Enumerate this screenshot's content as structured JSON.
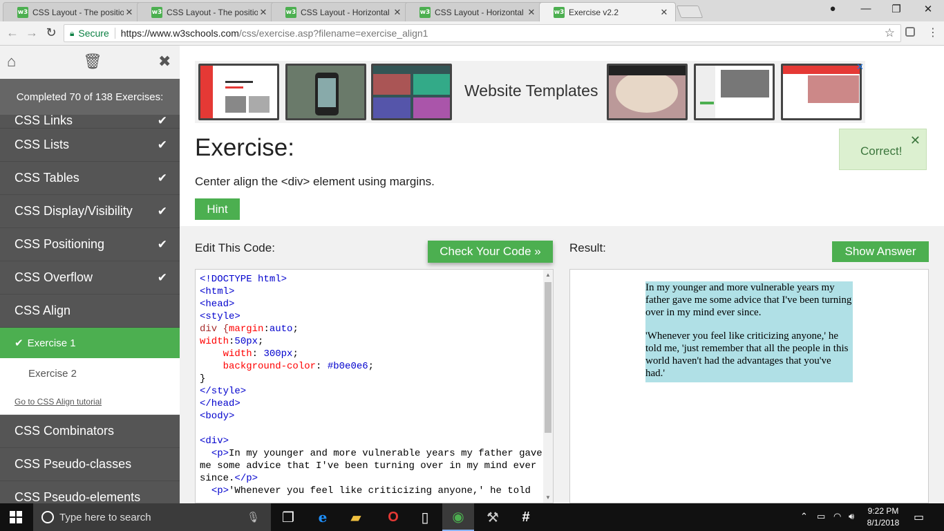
{
  "browser": {
    "tabs": [
      {
        "title": "CSS Layout - The position",
        "favicon": "w3"
      },
      {
        "title": "CSS Layout - The position",
        "favicon": "w3"
      },
      {
        "title": "CSS Layout - Horizontal &",
        "favicon": "w3"
      },
      {
        "title": "CSS Layout - Horizontal &",
        "favicon": "w3"
      },
      {
        "title": "Exercise v2.2",
        "favicon": "w3"
      }
    ],
    "active_tab": 4,
    "secure_label": "Secure",
    "url_host": "https://www.w3schools.com",
    "url_rest": "/css/exercise.asp?filename=exercise_align1"
  },
  "sidebar": {
    "completed": "Completed 70 of 138 Exercises:",
    "partial_item": "CSS Links",
    "items_top": [
      {
        "label": "CSS Lists",
        "done": true
      },
      {
        "label": "CSS Tables",
        "done": true
      },
      {
        "label": "CSS Display/Visibility",
        "done": true
      },
      {
        "label": "CSS Positioning",
        "done": true
      },
      {
        "label": "CSS Overflow",
        "done": true
      },
      {
        "label": "CSS Align",
        "done": false
      }
    ],
    "sub_items": [
      {
        "label": "Exercise 1",
        "active": true
      },
      {
        "label": "Exercise 2",
        "active": false
      }
    ],
    "tutorial_link": "Go to CSS Align tutorial",
    "items_bottom": [
      {
        "label": "CSS Combinators"
      },
      {
        "label": "CSS Pseudo-classes"
      },
      {
        "label": "CSS Pseudo-elements"
      }
    ]
  },
  "ad": {
    "text": "Website Templates"
  },
  "exercise": {
    "title": "Exercise:",
    "instruction": "Center align the <div> element using margins.",
    "hint": "Hint",
    "correct": "Correct!",
    "edit_label": "Edit This Code:",
    "check_button": "Check Your Code »",
    "result_label": "Result:",
    "answer_button": "Show Answer",
    "result_paragraphs": [
      "In my younger and more vulnerable years my father gave me some advice that I've been turning over in my mind ever since.",
      "'Whenever you feel like criticizing anyone,' he told me, 'just remember that all the people in this world haven't had the advantages that you've had.'"
    ]
  },
  "code": {
    "doctype": "<!DOCTYPE html>",
    "html_open": "<html>",
    "head_open": "<head>",
    "style_open": "<style>",
    "div_sel": "div {",
    "margin_prop": "margin",
    "margin_val": "auto",
    "width1_prop": "width",
    "width1_val": "50px",
    "width2_prop": "width",
    "width2_val": "300px",
    "bg_prop": "background-color",
    "bg_val": "#b0e0e6",
    "close_brace": "}",
    "style_close": "</style>",
    "head_close": "</head>",
    "body_open": "<body>",
    "div_open": "<div>",
    "p1_open": "<p>",
    "p1_text": "In my younger and more vulnerable years my father gave me some advice that I've been turning over in my mind ever since.",
    "p1_close": "</p>",
    "p2_open": "<p>",
    "p2_text": "'Whenever you feel like criticizing anyone,' he told"
  },
  "taskbar": {
    "search_placeholder": "Type here to search",
    "time": "9:22 PM",
    "date": "8/1/2018"
  },
  "colors": {
    "accent": "#4caf50",
    "result_bg": "#b0e0e6"
  }
}
